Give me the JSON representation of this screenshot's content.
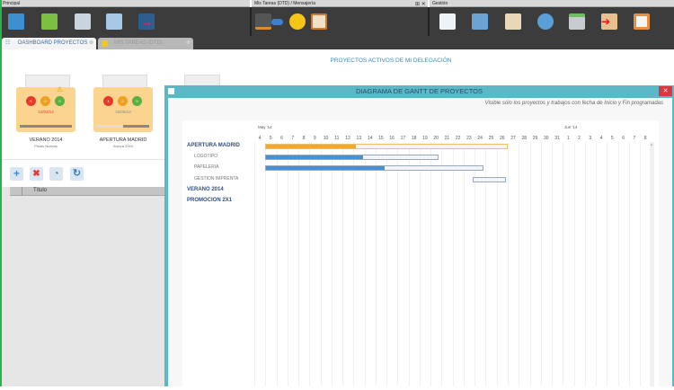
{
  "panels": {
    "principal": "Principal",
    "tareas": "Mis Tareas (DTD) / Mensajería",
    "gestion": "Gestión"
  },
  "tabs": [
    {
      "label": "DASHBOARD PROYECTOS"
    },
    {
      "label": "MIS TAREAS (DTD)"
    }
  ],
  "folders": [
    {
      "title": "VERANO 2014",
      "subtitle": "Pistas Nuevas",
      "date": "12/03/14",
      "dots": [
        "0",
        "0",
        "0"
      ],
      "progress": 1.0,
      "warning": true
    },
    {
      "title": "APERTURA MADRID",
      "subtitle": "Aurora 2000",
      "date": "26/05/14",
      "dots": [
        "1",
        "2",
        "0"
      ],
      "progress": 0.5,
      "warning": false
    }
  ],
  "table": {
    "header": "Título"
  },
  "dialog": {
    "title": "DIAGRAMA DE GANTT DE PROYECTOS",
    "note": "Visible sólo los proyectos y trabajos con fecha de Inicio y Fin programadas",
    "month1": "May '14",
    "month2": "Jun '14",
    "days": [
      "4",
      "5",
      "6",
      "7",
      "8",
      "9",
      "10",
      "11",
      "12",
      "13",
      "14",
      "15",
      "16",
      "17",
      "18",
      "19",
      "20",
      "21",
      "22",
      "23",
      "24",
      "25",
      "26",
      "27",
      "28",
      "29",
      "30",
      "31",
      "1",
      "2",
      "3",
      "4",
      "5",
      "6",
      "7",
      "8"
    ],
    "rows": [
      {
        "label": "APERTURA MADRID",
        "type": "project",
        "start": 1,
        "end": 23,
        "done": 8.2,
        "color": "#f0a830"
      },
      {
        "label": "LOGOTIPO",
        "type": "task",
        "start": 1,
        "end": 16.7,
        "done": 8.9,
        "color": "#4a90d0"
      },
      {
        "label": "PAPELERIA",
        "type": "task",
        "start": 1,
        "end": 20.8,
        "done": 10.8,
        "color": "#4a90d0"
      },
      {
        "label": "GESTION IMPRENTA",
        "type": "task",
        "start": 19.8,
        "end": 22.8,
        "done": 0,
        "color": "#4a90d0"
      },
      {
        "label": "VERANO 2014",
        "type": "project"
      },
      {
        "label": "PROMOCION 2X1",
        "type": "project"
      }
    ]
  },
  "center_title": "PROYECTOS ACTIVOS DE MI DELEGACIÓN"
}
